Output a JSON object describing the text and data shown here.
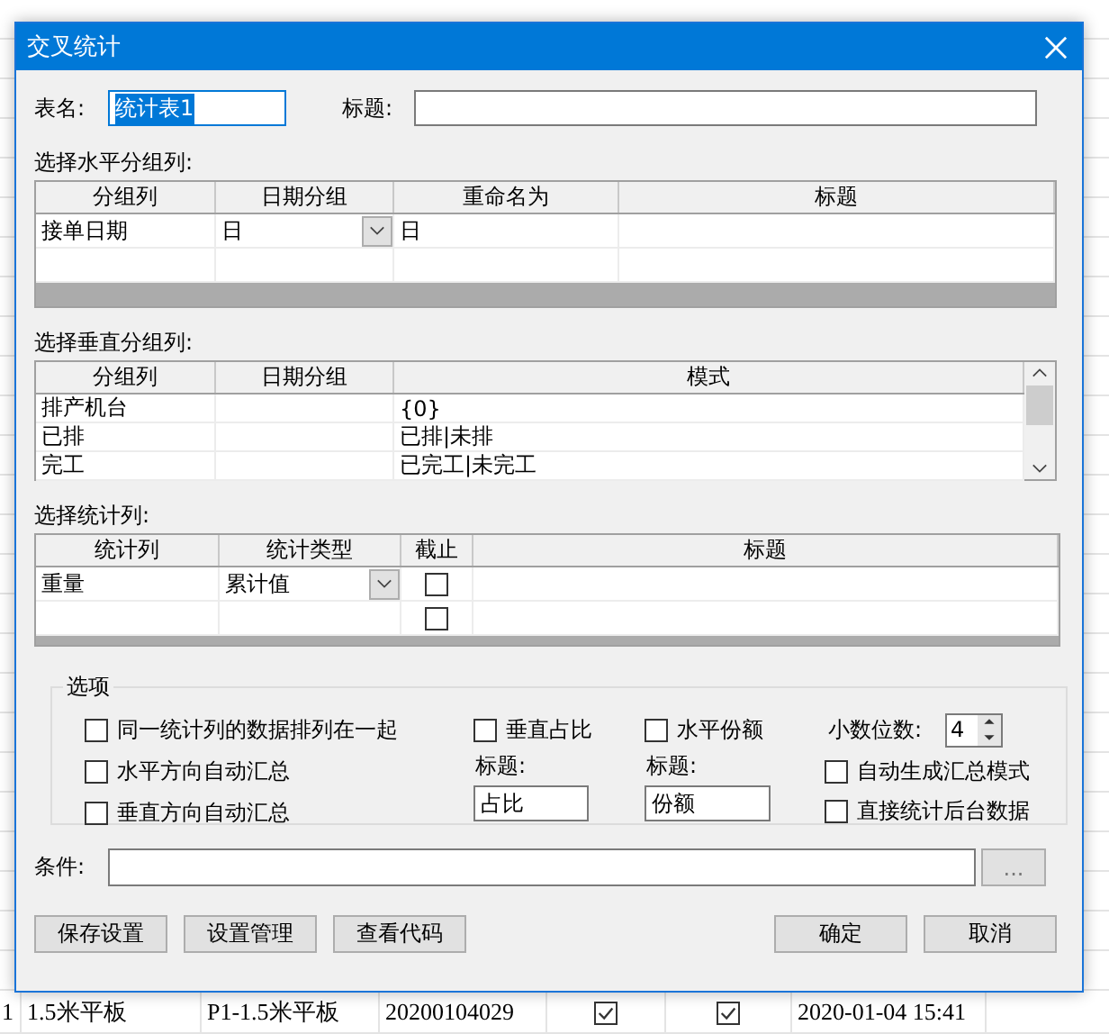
{
  "background_sheet": {
    "rows": [
      {
        "cells": [
          "1",
          "1.5米平板",
          "P1-1.5米平板",
          "20200104029"
        ],
        "checks": [
          true,
          true
        ],
        "time": "2020-01-04 15:41"
      }
    ]
  },
  "dialog": {
    "title": "交叉统计"
  },
  "table_name": {
    "label": "表名:",
    "value": "统计表1"
  },
  "title_field": {
    "label": "标题:"
  },
  "horizontal_group": {
    "label": "选择水平分组列:",
    "columns": [
      "分组列",
      "日期分组",
      "重命名为",
      "标题"
    ],
    "rows": [
      {
        "kind": "edit",
        "group_column": "接单日期",
        "date_group": "日",
        "rename": "日"
      },
      {
        "kind": "empty"
      }
    ]
  },
  "vertical_group": {
    "label": "选择垂直分组列:",
    "columns": [
      "分组列",
      "日期分组",
      "模式"
    ],
    "rows": [
      {
        "group_column": "排产机台",
        "pattern": "{0}"
      },
      {
        "group_column": "已排",
        "pattern": "已排|未排"
      },
      {
        "group_column": "完工",
        "pattern": "已完工|未完工"
      }
    ]
  },
  "stat_columns": {
    "label": "选择统计列:",
    "columns": [
      "统计列",
      "统计类型",
      "截止",
      "标题"
    ],
    "rows": [
      {
        "kind": "edit",
        "column": "重量",
        "type": "累计值",
        "cutoff": false
      },
      {
        "kind": "empty",
        "cutoff": false
      }
    ]
  },
  "options": {
    "legend": "选项",
    "left_checks": [
      {
        "label": "同一统计列的数据排列在一起",
        "checked": false
      },
      {
        "label": "水平方向自动汇总",
        "checked": false
      },
      {
        "label": "垂直方向自动汇总",
        "checked": false
      }
    ],
    "vertical_ratio": {
      "label": "垂直占比",
      "checked": false,
      "title_label": "标题:",
      "title_value": "占比"
    },
    "horizontal_share": {
      "label": "水平份额",
      "checked": false,
      "title_label": "标题:",
      "title_value": "份额"
    },
    "decimals": {
      "label": "小数位数:",
      "value": "4"
    },
    "right_checks": [
      {
        "label": "自动生成汇总模式",
        "checked": false
      },
      {
        "label": "直接统计后台数据",
        "checked": false
      }
    ]
  },
  "condition": {
    "label": "条件:",
    "browse": "..."
  },
  "buttons_left": [
    "保存设置",
    "设置管理",
    "查看代码"
  ],
  "buttons_right": [
    "确定",
    "取消"
  ]
}
